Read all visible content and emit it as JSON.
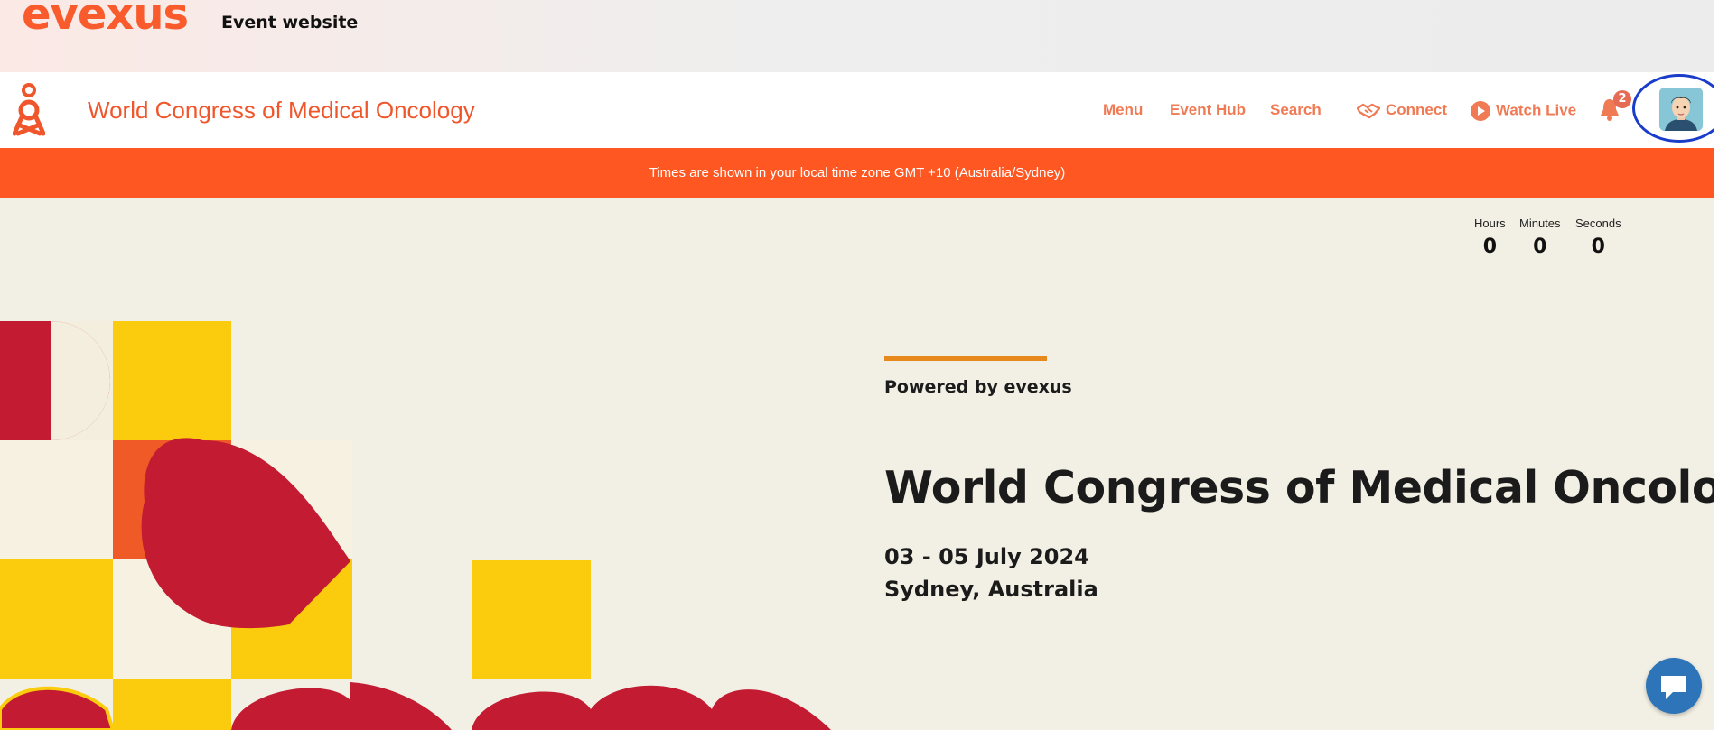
{
  "topbar": {
    "brand": "evexus",
    "subtitle": "Event website"
  },
  "navbar": {
    "site_title": "World Congress of Medical Oncology",
    "links": {
      "menu": "Menu",
      "event_hub": "Event Hub",
      "search": "Search",
      "connect": "Connect",
      "watch_live": "Watch Live"
    },
    "notification_count": "2",
    "icons": [
      "person-logo-icon",
      "handshake-icon",
      "play-circle-icon",
      "bell-icon",
      "user-avatar-icon"
    ]
  },
  "banner": {
    "timezone_text": "Times are shown in your local time zone GMT +10 (Australia/Sydney)"
  },
  "countdown": {
    "hours_label": "Hours",
    "hours": "0",
    "minutes_label": "Minutes",
    "minutes": "0",
    "seconds_label": "Seconds",
    "seconds": "0"
  },
  "hero": {
    "powered_by": "Powered by evexus",
    "title": "World Congress of Medical Oncology",
    "dates": "03 - 05 July 2024",
    "location": "Sydney, Australia"
  },
  "colors": {
    "brand_orange": "#ff5722",
    "art_red": "#c21b32",
    "art_yellow": "#fbcc0d",
    "avatar_ring": "#1a3dc9",
    "chat_blue": "#2d74b8"
  }
}
